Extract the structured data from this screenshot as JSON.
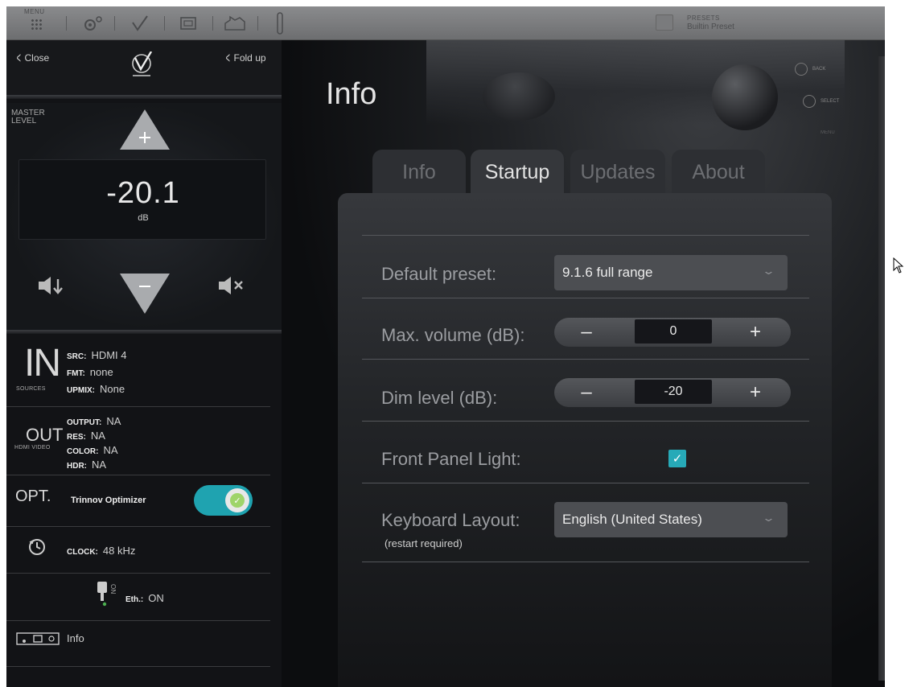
{
  "toolbar": {
    "menu_label": "MENU",
    "presets_label": "PRESETS",
    "preset_name": "Builtin Preset",
    "icons": [
      "menu-grid-icon",
      "gear-icon",
      "checkmark-icon",
      "display-icon",
      "room-icon",
      "microphone-icon",
      "folder-icon"
    ]
  },
  "left_panel": {
    "close_label": "Close",
    "fold_label": "Fold up",
    "master_level_label": "MASTER LEVEL",
    "level_value": "-20.1",
    "level_unit": "dB",
    "input": {
      "big_label": "IN",
      "caption": "SOURCES",
      "src_key": "SRC:",
      "src_val": "HDMI 4",
      "fmt_key": "FMT:",
      "fmt_val": "none",
      "upmix_key": "UPMIX:",
      "upmix_val": "None"
    },
    "output": {
      "big_label": "OUT",
      "caption": "HDMI VIDEO",
      "output_key": "OUTPUT:",
      "output_val": "NA",
      "res_key": "RES:",
      "res_val": "NA",
      "color_key": "COLOR:",
      "color_val": "NA",
      "hdr_key": "HDR:",
      "hdr_val": "NA"
    },
    "optimizer": {
      "big_label": "OPT.",
      "name": "Trinnov Optimizer",
      "enabled": true
    },
    "clock": {
      "key": "CLOCK:",
      "val": "48 kHz"
    },
    "ethernet": {
      "side_label": "ON",
      "key": "Eth.:",
      "val": "ON"
    },
    "info_label": "Info"
  },
  "main": {
    "title": "Info",
    "tabs": [
      {
        "label": "Info",
        "active": false
      },
      {
        "label": "Startup",
        "active": true
      },
      {
        "label": "Updates",
        "active": false
      },
      {
        "label": "About",
        "active": false
      }
    ],
    "settings": {
      "default_preset_label": "Default preset:",
      "default_preset_value": "9.1.6 full range",
      "max_volume_label": "Max. volume (dB):",
      "max_volume_value": "0",
      "dim_level_label": "Dim level (dB):",
      "dim_level_value": "-20",
      "front_panel_label": "Front Panel Light:",
      "front_panel_checked": true,
      "keyboard_label": "Keyboard Layout:",
      "keyboard_note": "(restart required)",
      "keyboard_value": "English (United States)"
    },
    "device_labels": {
      "back": "BACK",
      "select": "SELECT",
      "menu": "MENU"
    }
  },
  "colors": {
    "accent": "#1fa3b0",
    "check": "#27aab8",
    "toggle_knob": "#9fd46a"
  }
}
